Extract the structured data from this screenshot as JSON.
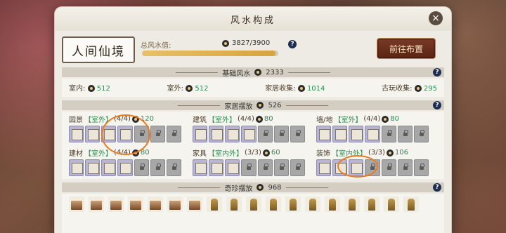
{
  "title": "风水构成",
  "place_name": "人间仙境",
  "total": {
    "label": "总风水值:",
    "value": "3827/3900",
    "progress": 0.98
  },
  "goto_button": "前往布置",
  "basic": {
    "header": "基础风水",
    "value": "2333",
    "items": [
      {
        "label": "室内:",
        "value": "512"
      },
      {
        "label": "室外:",
        "value": "512"
      },
      {
        "label": "家居收集:",
        "value": "1014"
      },
      {
        "label": "古玩收集:",
        "value": "295"
      }
    ]
  },
  "furniture": {
    "header": "家居摆放",
    "value": "526",
    "categories": [
      {
        "name": "园景",
        "tag": "【室外】",
        "count": "(4/4)",
        "value": "120"
      },
      {
        "name": "建筑",
        "tag": "【室外】",
        "count": "(4/4)",
        "value": "80"
      },
      {
        "name": "墙/地",
        "tag": "【室外】",
        "count": "(4/4)",
        "value": "80"
      },
      {
        "name": "建材",
        "tag": "【室外】",
        "count": "(4/4)",
        "value": "80"
      },
      {
        "name": "家具",
        "tag": "【室内外】",
        "count": "(3/3)",
        "value": "60"
      },
      {
        "name": "装饰",
        "tag": "【室内外】",
        "count": "(3/3)",
        "value": "106"
      }
    ]
  },
  "rare": {
    "header": "奇珍摆放",
    "value": "968"
  }
}
